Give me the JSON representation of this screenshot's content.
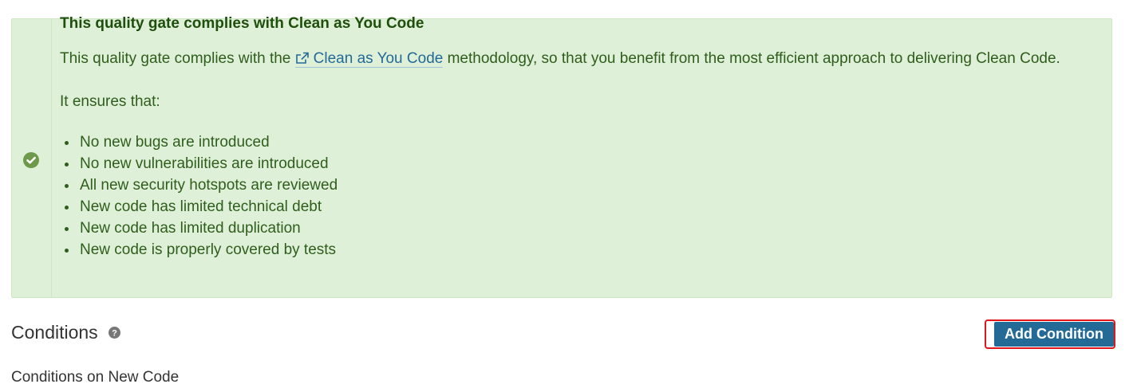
{
  "alert": {
    "title": "This quality gate complies with Clean as You Code",
    "text_before_link": "This quality gate complies with the ",
    "link_label": "Clean as You Code",
    "text_after_link": " methodology, so that you benefit from the most efficient approach to delivering Clean Code.",
    "ensures_label": "It ensures that:",
    "requirements": [
      "No new bugs are introduced",
      "No new vulnerabilities are introduced",
      "All new security hotspots are reviewed",
      "New code has limited technical debt",
      "New code has limited duplication",
      "New code is properly covered by tests"
    ],
    "status_icon": "check-circle-icon"
  },
  "conditions": {
    "title": "Conditions",
    "help_icon": "question-circle-icon",
    "add_button_label": "Add Condition",
    "subheading_partial": "Conditions on New Code"
  },
  "colors": {
    "alert_bg": "#dff0d8",
    "alert_text": "#2f5d1c",
    "link": "#236a97",
    "button_bg": "#236a97",
    "highlight": "#e0161c",
    "check_icon": "#6d9a4a"
  }
}
